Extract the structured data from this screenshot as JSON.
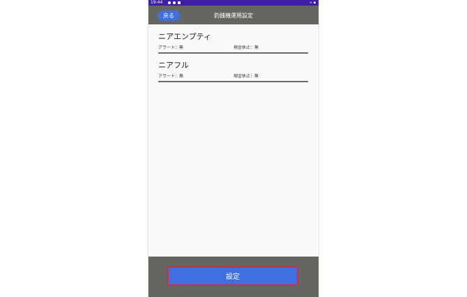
{
  "status_bar": {
    "time": "19:44",
    "right_text": "≈ ▪"
  },
  "app_bar": {
    "back_label": "戻る",
    "title": "釣銭機運用設定"
  },
  "sections": [
    {
      "heading": "ニアエンプティ",
      "alert": "アラート：無",
      "cash_stop": "現金休止：無"
    },
    {
      "heading": "ニアフル",
      "alert": "アラート：無",
      "cash_stop": "現金休止：無"
    }
  ],
  "footer": {
    "set_label": "設定"
  },
  "colors": {
    "accent": "#3f6fe0",
    "bar": "#656562",
    "status": "#3d1fa6",
    "highlight_border": "#d42c3c"
  }
}
